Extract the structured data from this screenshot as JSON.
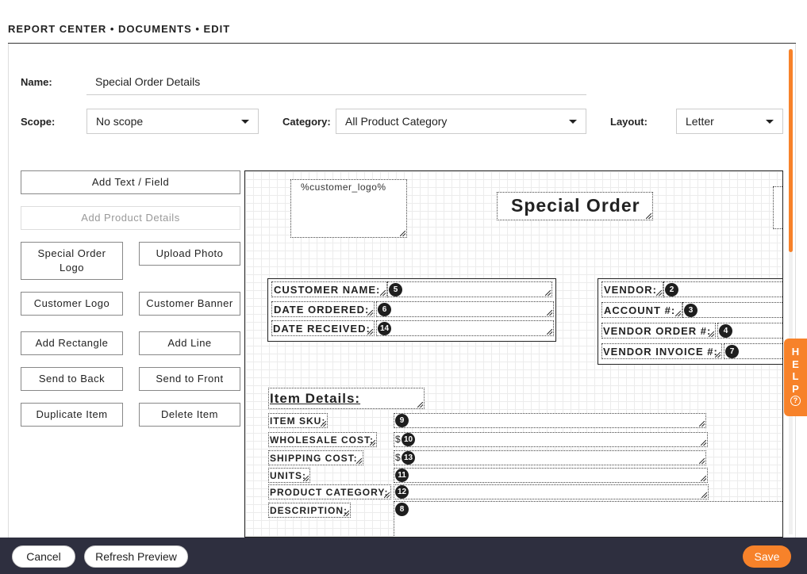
{
  "breadcrumb": "REPORT CENTER • DOCUMENTS • EDIT",
  "form": {
    "name_label": "Name:",
    "name_value": "Special Order Details",
    "scope_label": "Scope:",
    "scope_value": "No scope",
    "category_label": "Category:",
    "category_value": "All Product Category",
    "layout_label": "Layout:",
    "layout_value": "Letter"
  },
  "tools": {
    "add_text_field": "Add Text / Field",
    "add_product_details": "Add Product Details",
    "special_order_logo": "Special Order Logo",
    "upload_photo": "Upload Photo",
    "customer_logo": "Customer Logo",
    "customer_banner": "Customer Banner",
    "add_rectangle": "Add Rectangle",
    "add_line": "Add Line",
    "send_to_back": "Send to Back",
    "send_to_front": "Send to Front",
    "duplicate_item": "Duplicate Item",
    "delete_item": "Delete Item"
  },
  "canvas": {
    "logo_placeholder": "%customer_logo%",
    "title": "Special Order",
    "customer_fields": [
      {
        "label": "CUSTOMER NAME:",
        "badge": "5"
      },
      {
        "label": "DATE ORDERED:",
        "badge": "6"
      },
      {
        "label": "DATE RECEIVED:",
        "badge": "14"
      }
    ],
    "vendor_fields": [
      {
        "label": "VENDOR:",
        "badge": "2"
      },
      {
        "label": "ACCOUNT #:",
        "badge": "3"
      },
      {
        "label": "VENDOR ORDER #:",
        "badge": "4"
      },
      {
        "label": "VENDOR INVOICE #:",
        "badge": "7"
      }
    ],
    "item_details_heading": "Item Details:",
    "item_fields": [
      {
        "label": "ITEM SKU:",
        "badge": "9",
        "prefix": ""
      },
      {
        "label": "WHOLESALE COST:",
        "badge": "10",
        "prefix": "$"
      },
      {
        "label": "SHIPPING COST:",
        "badge": "13",
        "prefix": "$"
      },
      {
        "label": "UNITS:",
        "badge": "11",
        "prefix": ""
      },
      {
        "label": "PRODUCT CATEGORY:",
        "badge": "12",
        "prefix": ""
      },
      {
        "label": "DESCRIPTION:",
        "badge": "8",
        "prefix": ""
      }
    ]
  },
  "help": {
    "letters": [
      "H",
      "E",
      "L",
      "P"
    ],
    "icon": "?"
  },
  "footer": {
    "cancel": "Cancel",
    "refresh_preview": "Refresh Preview",
    "save": "Save"
  },
  "colors": {
    "accent": "#f7822a",
    "footer_bg": "#2e2f3f"
  }
}
